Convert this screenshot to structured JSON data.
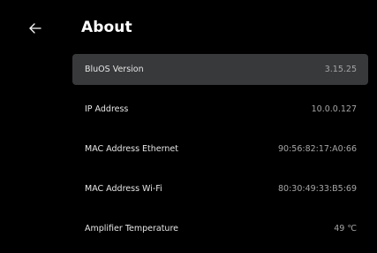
{
  "header": {
    "title": "About",
    "back_icon": "arrow-left-icon"
  },
  "colors": {
    "background": "#000000",
    "selected_row": "#38393b",
    "label_text": "#e6e6e6",
    "value_text": "#a5a5a5"
  },
  "rows": [
    {
      "label": "BluOS Version",
      "value": "3.15.25",
      "selected": true
    },
    {
      "label": "IP Address",
      "value": "10.0.0.127",
      "selected": false
    },
    {
      "label": "MAC Address Ethernet",
      "value": "90:56:82:17:A0:66",
      "selected": false
    },
    {
      "label": "MAC Address Wi-Fi",
      "value": "80:30:49:33:B5:69",
      "selected": false
    },
    {
      "label": "Amplifier Temperature",
      "value": "49 ℃",
      "selected": false
    }
  ]
}
